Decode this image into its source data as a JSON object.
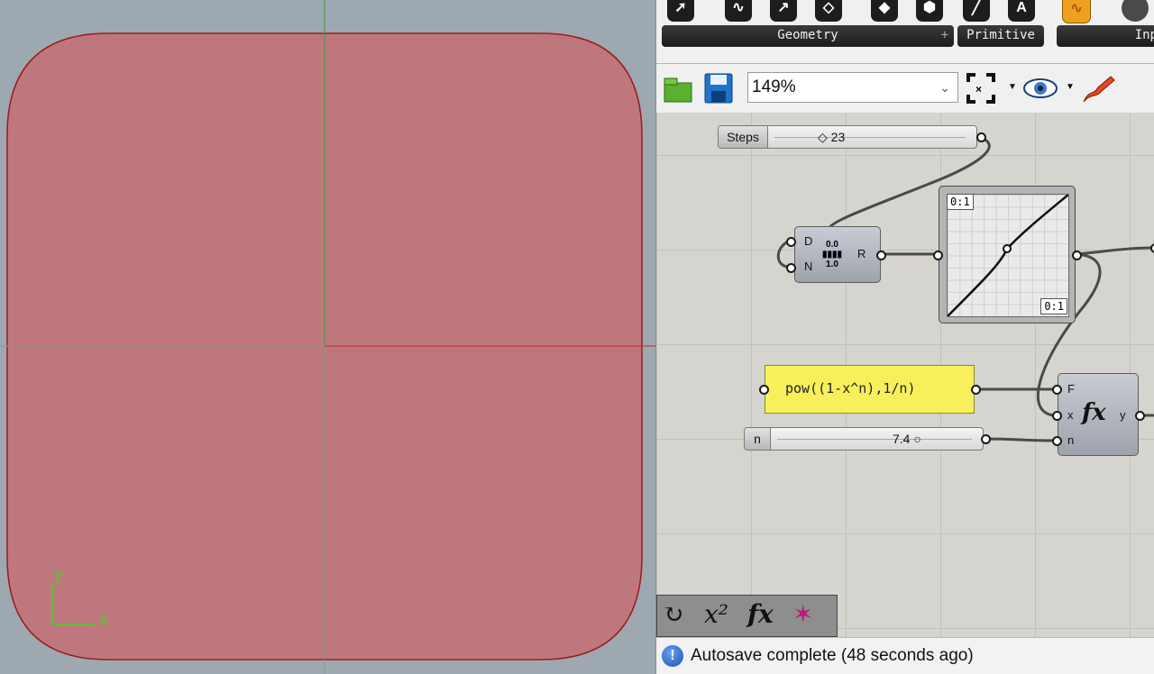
{
  "viewport": {
    "axis_x_label": "x",
    "axis_y_label": "y",
    "shape_fill": "#c0757a",
    "shape_stroke": "#9c1a20",
    "background": "#9da8b0"
  },
  "ribbon": {
    "groups": [
      {
        "label": "Geometry",
        "icons": [
          "point-icon",
          "curve-icon",
          "vector-icon",
          "plane-icon",
          "box-icon",
          "brep-icon"
        ]
      },
      {
        "label": "Primitive",
        "icons": [
          "boolean-icon",
          "text-icon"
        ]
      },
      {
        "label": "Inp",
        "icons": [
          "graph-mapper-icon",
          "knob-icon"
        ]
      }
    ]
  },
  "toolbar": {
    "zoom": "149%",
    "icons": [
      "open-file-icon",
      "save-icon",
      "zoom-extents-icon",
      "preview-eye-icon",
      "sketch-pen-icon"
    ]
  },
  "canvas": {
    "steps_slider": {
      "name": "Steps",
      "value": "23"
    },
    "range_component": {
      "inputs": [
        "D",
        "N"
      ],
      "output": "R",
      "icon_top": "0.0",
      "icon_bottom": "1.0"
    },
    "graph_mapper": {
      "x_domain": "0:1",
      "y_domain": "0:1"
    },
    "expression_panel": {
      "text": "pow((1-x^n),1/n)"
    },
    "n_slider": {
      "name": "n",
      "value": "7.4"
    },
    "eval_component": {
      "inputs": [
        "F",
        "x",
        "n"
      ],
      "output": "y",
      "icon_glyph": "fx"
    }
  },
  "expression_toolbar": {
    "icons": [
      "shuffle-icon",
      "power-icon",
      "function-icon",
      "star-icon"
    ],
    "power_label": "x²",
    "function_label": "fx"
  },
  "status": {
    "message": "Autosave complete (48 seconds ago)"
  }
}
